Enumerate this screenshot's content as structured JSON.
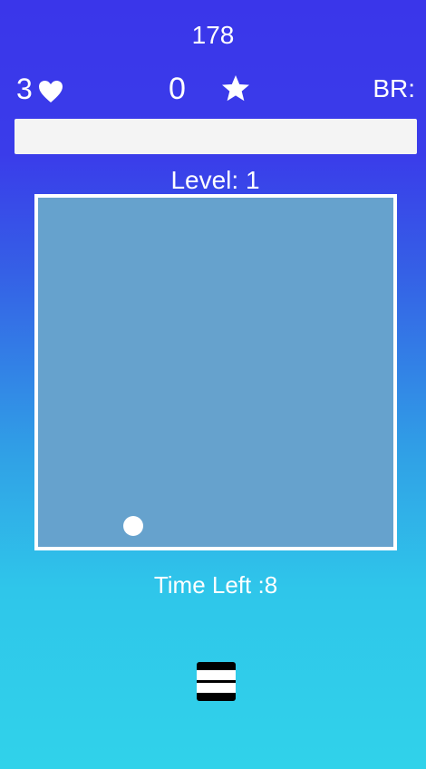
{
  "hud": {
    "top_score": "178",
    "lives": "3",
    "lives_icon": "heart-icon",
    "stars": "0",
    "stars_icon": "star-icon",
    "br_label": "BR:"
  },
  "progress_bar": {
    "fill_fraction": 0
  },
  "level": {
    "label": "Level: 1"
  },
  "play_field": {
    "border_color": "#ffffff",
    "background_color": "#66a2cd",
    "ball_color": "#ffffff"
  },
  "timer": {
    "label": "Time Left :8"
  },
  "controls": {
    "pause_icon": "pause-icon"
  },
  "colors": {
    "background_top": "#3a36ea",
    "background_bottom": "#30d2ea",
    "text": "#ffffff"
  }
}
